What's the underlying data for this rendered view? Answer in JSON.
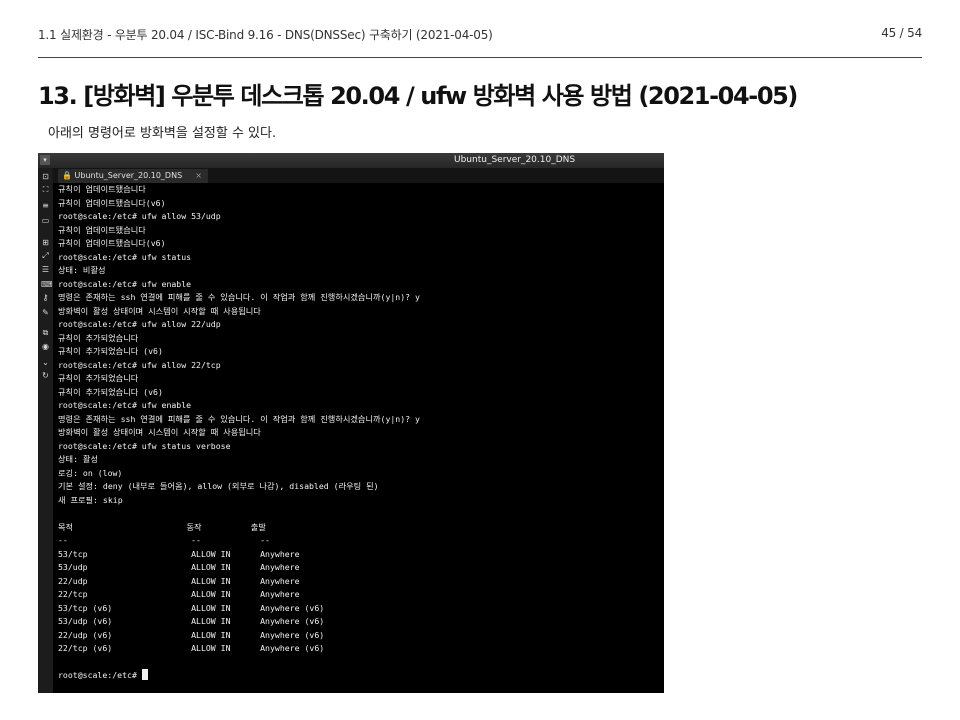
{
  "header": {
    "running_title": "1.1 실제환경 - 우분투 20.04 / ISC-Bind 9.16 - DNS(DNSSec) 구축하기 (2021-04-05)",
    "page_number": "45 / 54"
  },
  "section": {
    "title": "13. [방화벽] 우분투 데스크톱 20.04 / ufw 방화벽 사용 방법 (2021-04-05)",
    "description": "아래의 명령어로 방화벽을 설정할 수 있다."
  },
  "terminal_window": {
    "window_title": "Ubuntu_Server_20.10_DNS",
    "tab_label": "Ubuntu_Server_20.10_DNS",
    "tab_close": "×",
    "menu_glyph": "▾",
    "toolbar_icons": [
      "screenshot-icon",
      "fullscreen-icon",
      "menu-lines-icon",
      "window-icon",
      "fit-icon",
      "scale-icon",
      "list-icon",
      "keyboard-icon",
      "keys-icon",
      "wrench-icon",
      "copy-icon",
      "camera-icon",
      "chevron-down-icon",
      "refresh-icon"
    ],
    "lines": [
      "규칙이 업데이트됐습니다",
      "규칙이 업데이트됐습니다(v6)",
      "root@scale:/etc# ufw allow 53/udp",
      "규칙이 업데이트됐습니다",
      "규칙이 업데이트됐습니다(v6)",
      "root@scale:/etc# ufw status",
      "상태: 비활성",
      "root@scale:/etc# ufw enable",
      "명령은 존재하는 ssh 연결에 피해를 줄 수 있습니다. 이 작업과 함께 진행하시겠습니까(y|n)? y",
      "방화벽이 활성 상태이며 시스템이 시작할 때 사용됩니다",
      "root@scale:/etc# ufw allow 22/udp",
      "규칙이 추가되었습니다",
      "규칙이 추가되었습니다 (v6)",
      "root@scale:/etc# ufw allow 22/tcp",
      "규칙이 추가되었습니다",
      "규칙이 추가되었습니다 (v6)",
      "root@scale:/etc# ufw enable",
      "명령은 존재하는 ssh 연결에 피해를 줄 수 있습니다. 이 작업과 함께 진행하시겠습니까(y|n)? y",
      "방화벽이 활성 상태이며 시스템이 시작할 때 사용됩니다",
      "root@scale:/etc# ufw status verbose",
      "상태: 활성",
      "로깅: on (low)",
      "기본 설정: deny (내부로 들어옴), allow (외부로 나감), disabled (라우팅 된)",
      "새 프로필: skip",
      "",
      "목적                       동작          출발",
      "--                         --            --",
      "53/tcp                     ALLOW IN      Anywhere",
      "53/udp                     ALLOW IN      Anywhere",
      "22/udp                     ALLOW IN      Anywhere",
      "22/tcp                     ALLOW IN      Anywhere",
      "53/tcp (v6)                ALLOW IN      Anywhere (v6)",
      "53/udp (v6)                ALLOW IN      Anywhere (v6)",
      "22/udp (v6)                ALLOW IN      Anywhere (v6)",
      "22/tcp (v6)                ALLOW IN      Anywhere (v6)",
      "",
      "root@scale:/etc# "
    ]
  }
}
